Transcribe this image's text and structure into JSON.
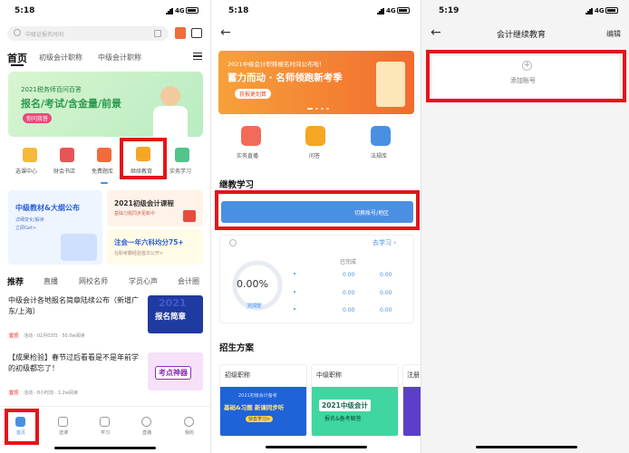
{
  "p1": {
    "time": "5:18",
    "signal": "4G",
    "search_placeholder": "中级证报名时间",
    "tabs": [
      "首页",
      "初级会计职称",
      "中级会计职称"
    ],
    "banner": {
      "line1": "2021税务师百问百答",
      "line2": "报名/考试/含金量/前景",
      "button": "你问我答"
    },
    "icons": [
      "选课中心",
      "财会书店",
      "免费题库",
      "继续教育",
      "实务学习"
    ],
    "promo": {
      "left_title": "中级教材&大纲公布",
      "left_sub1": "详细变化/解读",
      "left_sub2": "立即Get>",
      "right_top_title": "2021初级会计课程",
      "right_top_sub": "基础习题同步更新中",
      "right_bottom_title": "注会一年六科均分75+",
      "right_bottom_sub": "在职考霸经验首次公开>"
    },
    "feed_tabs": [
      "推荐",
      "直播",
      "网校名师",
      "学员心声",
      "会计圈"
    ],
    "news": [
      {
        "title": "中级会计各地报名简章陆续公布（新增广东/上海）",
        "tag": "置顶",
        "meta": "活动 · 02月03日 · 50.0w阅读",
        "thumb": "报名简章",
        "thumb_year": "2021"
      },
      {
        "title": "【成果检验】春节过后看看是不是年前学的初级都忘了！",
        "tag": "置顶",
        "meta": "活动 · 8小时前 · 1.2w阅读",
        "thumb": "考点神器"
      }
    ],
    "bottom_nav": [
      "首页",
      "选课",
      "学习",
      "直播",
      "我的"
    ]
  },
  "p2": {
    "time": "5:18",
    "signal": "4G",
    "banner": {
      "line1": "2021中级会计职称报名时间公布啦！",
      "line2": "蓄力而动 · 名师领跑新考季",
      "button": "获报更划算"
    },
    "icons": [
      "实务直播",
      "问答",
      "法规库"
    ],
    "section_title": "继教学习",
    "switch_text": "切换账号/地区",
    "go_study": "去学习",
    "progress_pct": "0.00%",
    "progress_fraction": 0,
    "progress_label": "完成度",
    "done_header": "已完成",
    "stats": [
      [
        "0.00",
        "0.00"
      ],
      [
        "0.00",
        "0.00"
      ],
      [
        "0.00",
        "0.00"
      ]
    ],
    "admissions_title": "招生方案",
    "cards": [
      {
        "label": "初级职称",
        "line1": "2021初级会计备考",
        "line2": "基础&习题 新课同步听",
        "button": "快去学习>"
      },
      {
        "label": "中级职称",
        "line1": "2021中级会计",
        "line2": "报名&备考解答"
      },
      {
        "label": "注册"
      }
    ]
  },
  "p3": {
    "time": "5:19",
    "signal": "4G",
    "title": "会计继续教育",
    "edit": "编辑",
    "add_label": "添加账号"
  },
  "colors": {
    "accent": "#e5141a",
    "blue": "#4a90e2",
    "orange": "#f5a623"
  }
}
